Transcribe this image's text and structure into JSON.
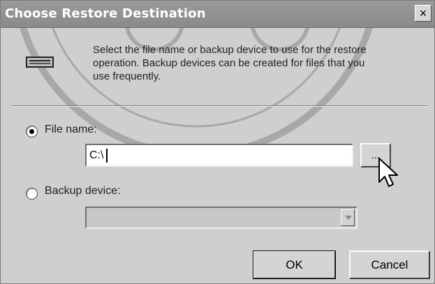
{
  "window": {
    "title": "Choose Restore Destination",
    "close_glyph": "×"
  },
  "info": {
    "line1": "Select the file name or backup device to use for the restore",
    "line2": "operation.  Backup devices can be created for files that you",
    "line3": "use frequently.",
    "icon": "tape-drive-icon"
  },
  "options": {
    "file_name": {
      "label": "File name:",
      "selected": true,
      "value": "C:\\"
    },
    "browse_label": "...",
    "backup_device": {
      "label": "Backup device:",
      "selected": false,
      "value": ""
    }
  },
  "buttons": {
    "ok": "OK",
    "cancel": "Cancel"
  },
  "colors": {
    "titlebar": "#8f8f8f",
    "dialog_bg": "#cfcfcf",
    "text": "#222222"
  }
}
